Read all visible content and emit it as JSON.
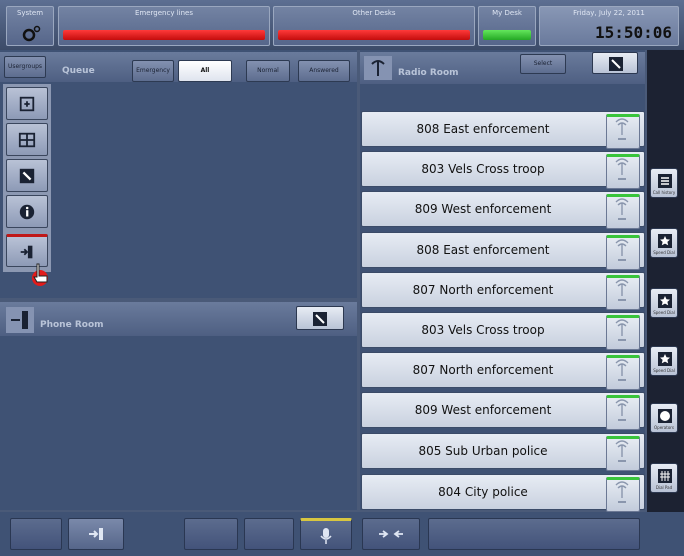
{
  "topbar": {
    "system_label": "System",
    "emergency_label": "Emergency lines",
    "other_desks_label": "Other Desks",
    "my_desk_label": "My Desk",
    "date": "Friday, July 22, 2011",
    "time": "15:50:06"
  },
  "queue": {
    "title": "Queue",
    "user_group_label": "Usergroups",
    "filters": [
      "Emergency",
      "All",
      "Normal",
      "Answered"
    ],
    "selected_filter": "All"
  },
  "side_menu": {
    "items": [
      "lock-icon",
      "grid-icon",
      "tools-icon",
      "info-icon",
      "logout-icon"
    ]
  },
  "phone_room": {
    "title": "Phone Room"
  },
  "radio_room": {
    "title": "Radio Room",
    "button_label": "Select",
    "channels": [
      "808 East enforcement",
      "803 Vels Cross troop",
      "809 West enforcement",
      "808 East enforcement",
      "807 North enforcement",
      "803 Vels Cross troop",
      "807 North enforcement",
      "809 West enforcement",
      "805 Sub Urban police",
      "804 City police"
    ]
  },
  "right_column": {
    "buttons": [
      {
        "icon": "list-icon",
        "caption": "Call history"
      },
      {
        "icon": "star-icon",
        "caption": "Speed Dial"
      },
      {
        "icon": "star-icon",
        "caption": "Speed Dial"
      },
      {
        "icon": "star-icon",
        "caption": "Speed Dial"
      },
      {
        "icon": "globe-icon",
        "caption": "Operators"
      },
      {
        "icon": "keypad-icon",
        "caption": "Dial Pad"
      }
    ]
  },
  "colors": {
    "alarm_red": "#e01d1d",
    "ok_green": "#3cc63c",
    "panel_blue": "#3f5274"
  }
}
